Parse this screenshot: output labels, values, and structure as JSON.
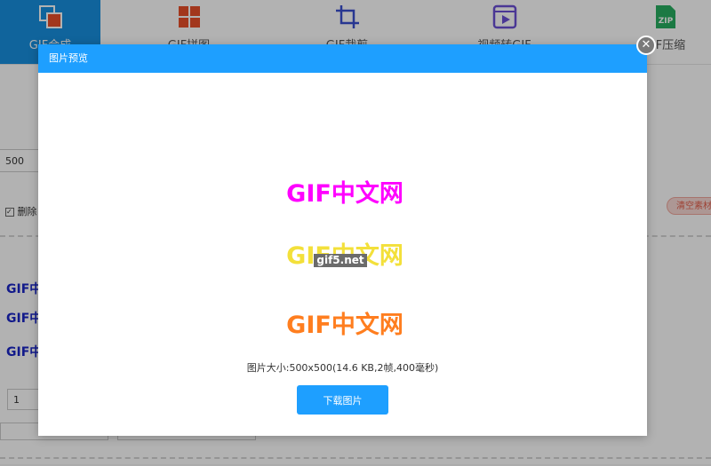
{
  "nav": {
    "items": [
      {
        "label": "GIF合成",
        "icon": "gif-merge-icon"
      },
      {
        "label": "GIF拼图",
        "icon": "gif-collage-icon"
      },
      {
        "label": "GIF裁剪",
        "icon": "gif-crop-icon"
      },
      {
        "label": "视频转GIF",
        "icon": "video-to-gif-icon"
      },
      {
        "label": "GIF压缩",
        "icon": "zip-compress-icon"
      }
    ],
    "zip_text": "ZIP"
  },
  "background": {
    "size_value": "500",
    "delete_label": "删除",
    "clear_label": "清空素材",
    "gif_rows": [
      "GIF中",
      "GIF中",
      "GIF中"
    ],
    "frame_value": "1"
  },
  "modal": {
    "title": "图片预览",
    "close_symbol": "✕",
    "preview_lines": [
      {
        "text": "GIF中文网",
        "color": "#ff00ff"
      },
      {
        "text": "GIF中文网",
        "color": "#f3e03a"
      },
      {
        "text": "GIF中文网",
        "color": "#ff7e1f"
      }
    ],
    "watermark": "gif5.net",
    "info": "图片大小:500x500(14.6 KB,2帧,400毫秒)",
    "download_label": "下载图片"
  },
  "colors": {
    "accent": "#1e9fff",
    "nav_active": "#1890e0"
  }
}
